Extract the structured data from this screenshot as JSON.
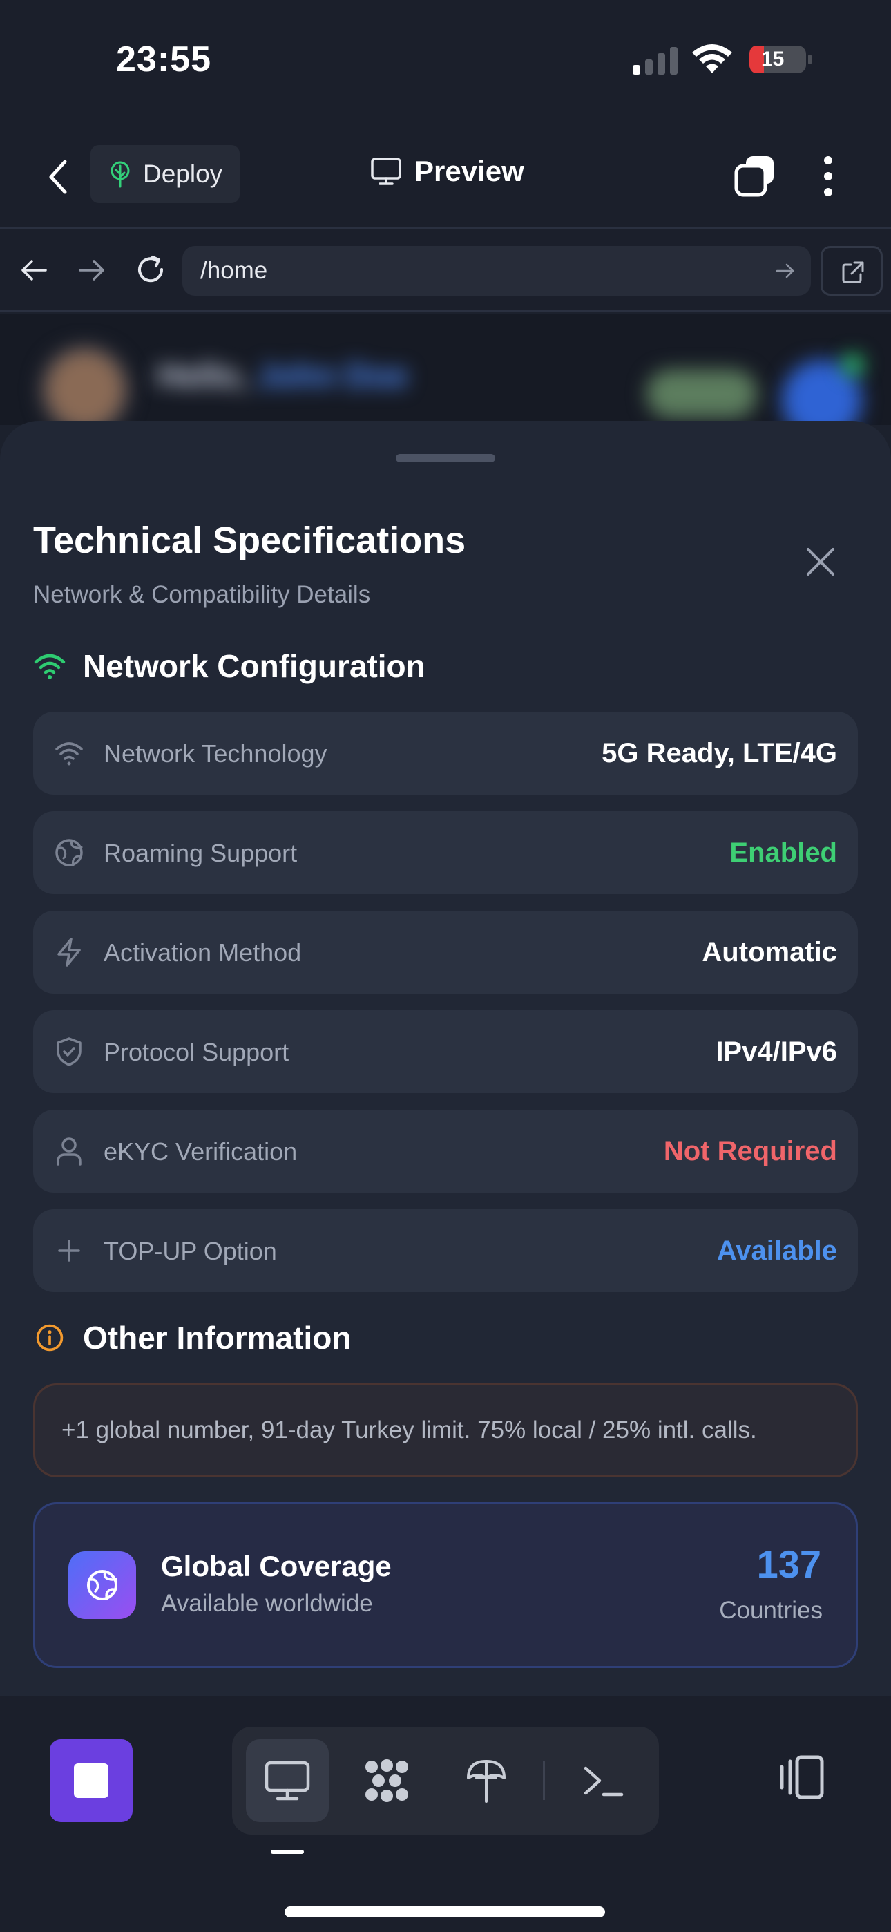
{
  "status_bar": {
    "time": "23:55",
    "battery_level": "15",
    "signal_bars_active": 1,
    "signal_bars_total": 4
  },
  "header": {
    "back_icon": "chevron-left-icon",
    "deploy_label": "Deploy",
    "deploy_icon": "tree-icon",
    "title": "Preview",
    "title_icon": "monitor-icon",
    "windows_icon": "windows-stack-icon",
    "more_icon": "vertical-dots-icon"
  },
  "browser": {
    "url": "/home",
    "back_icon": "arrow-left-icon",
    "forward_icon": "arrow-right-icon",
    "reload_icon": "reload-icon",
    "go_icon": "arrow-right-icon",
    "external_icon": "external-link-icon"
  },
  "underlying_page": {
    "greeting": "Hello, ",
    "user_name": "John Doe"
  },
  "sheet": {
    "title": "Technical Specifications",
    "subtitle": "Network & Compatibility Details",
    "close_icon": "close-icon",
    "network_section": {
      "title": "Network Configuration",
      "icon": "wifi-icon",
      "icon_color": "#2ecc71",
      "rows": [
        {
          "icon": "wifi-icon",
          "label": "Network Technology",
          "value": "5G Ready, LTE/4G",
          "color": "#ffffff"
        },
        {
          "icon": "globe-icon",
          "label": "Roaming Support",
          "value": "Enabled",
          "color": "#3ecf74"
        },
        {
          "icon": "lightning-icon",
          "label": "Activation Method",
          "value": "Automatic",
          "color": "#ffffff"
        },
        {
          "icon": "shield-check-icon",
          "label": "Protocol Support",
          "value": "IPv4/IPv6",
          "color": "#ffffff"
        },
        {
          "icon": "user-icon",
          "label": "eKYC Verification",
          "value": "Not Required",
          "color": "#f0656a"
        },
        {
          "icon": "plus-icon",
          "label": "TOP-UP Option",
          "value": "Available",
          "color": "#4d91ee"
        }
      ]
    },
    "other_section": {
      "title": "Other Information",
      "icon": "info-circle-icon",
      "icon_color": "#f39a2e",
      "text": "+1 global number, 91-day Turkey limit. 75% local / 25% intl. calls."
    },
    "coverage": {
      "icon": "globe-icon",
      "title": "Global Coverage",
      "subtitle": "Available worldwide",
      "count": "137",
      "unit": "Countries"
    }
  },
  "toolbar": {
    "stop_icon": "stop-icon",
    "tools": [
      {
        "name": "desktop-preview",
        "icon": "monitor-icon",
        "active": true
      },
      {
        "name": "integrations",
        "icon": "grid-blob-icon",
        "active": false
      },
      {
        "name": "deploy",
        "icon": "tree-icon",
        "active": false
      },
      {
        "name": "terminal",
        "icon": "terminal-icon",
        "active": false
      }
    ],
    "panels_icon": "panels-icon"
  }
}
